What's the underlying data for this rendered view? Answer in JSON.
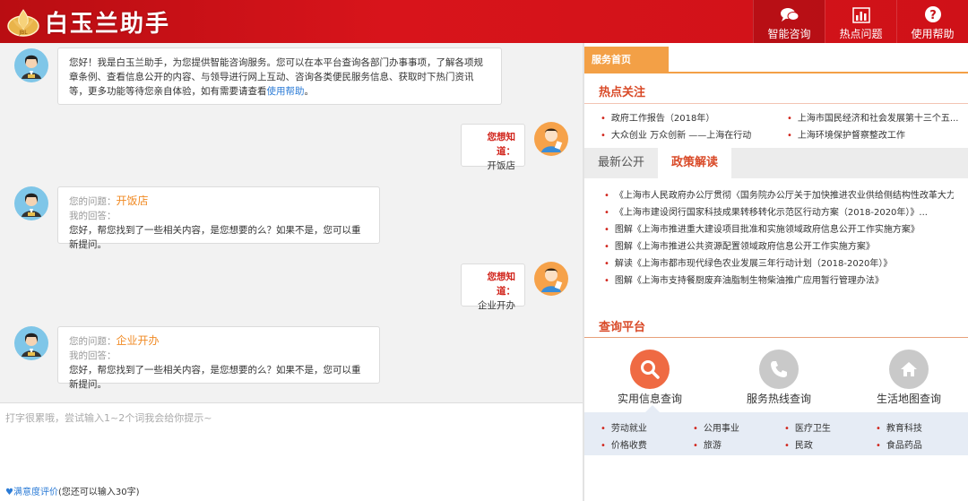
{
  "header": {
    "title": "白玉兰助手",
    "logo_icon": "magnolia-emblem-icon",
    "nav": [
      {
        "label": "智能咨询",
        "icon": "chat-bubbles-icon"
      },
      {
        "label": "热点问题",
        "icon": "bar-chart-icon"
      },
      {
        "label": "使用帮助",
        "icon": "question-circle-icon"
      }
    ],
    "brand_color": "#d8141b"
  },
  "chat": {
    "welcome": {
      "text": "您好！我是白玉兰助手，为您提供智能咨询服务。您可以在本平台查询各部门办事事项，了解各项规章条例、查看信息公开的内容、与领导进行网上互动、咨询各类便民服务信息、获取时下热门资讯等，更多功能等待您亲自体验，如有需要请查看",
      "link": "使用帮助",
      "end": "。"
    },
    "messages": [
      {
        "user_title": "您想知道：",
        "user_text": "开饭店",
        "q_label": "您的问题：",
        "q_value": "开饭店",
        "a_label": "我的回答：",
        "a_text": "您好，帮您找到了一些相关内容，是您想要的么？如果不是，您可以重新提问。"
      },
      {
        "user_title": "您想知道：",
        "user_text": "企业开办",
        "q_label": "您的问题：",
        "q_value": "企业开办",
        "a_label": "我的回答：",
        "a_text": "您好，帮您找到了一些相关内容，是您想要的么？如果不是，您可以重新提问。"
      }
    ]
  },
  "input": {
    "placeholder": "打字很累哦，尝试输入1~2个词我会给你提示~",
    "rating_link": "满意度评价",
    "rating_hint": "(您还可以输入30字)"
  },
  "right": {
    "service_tab": "服务首页",
    "hot_title": "热点关注",
    "hot_items": [
      "政府工作报告（2018年）",
      "上海市国民经济和社会发展第十三个五...",
      "大众创业 万众创新 ——上海在行动",
      "上海环境保护督察整改工作"
    ],
    "tabs": {
      "latest": "最新公开",
      "policy": "政策解读"
    },
    "policy_items": [
      "《上海市人民政府办公厅贯彻〈国务院办公厅关于加快推进农业供给侧结构性改革大力...",
      "《上海市建设闵行国家科技成果转移转化示范区行动方案（2018-2020年）》...",
      "图解《上海市推进重大建设项目批准和实施领域政府信息公开工作实施方案》",
      "图解《上海市推进公共资源配置领域政府信息公开工作实施方案》",
      "解读《上海市都市现代绿色农业发展三年行动计划（2018-2020年）》",
      "图解《上海市支持餐厨废弃油脂制生物柴油推广应用暂行管理办法》"
    ],
    "query_title": "查询平台",
    "query_items": [
      {
        "label": "实用信息查询",
        "icon": "search-icon",
        "color": "#ef6a43"
      },
      {
        "label": "服务热线查询",
        "icon": "phone-icon",
        "color": "#c9c9c9"
      },
      {
        "label": "生活地图查询",
        "icon": "home-icon",
        "color": "#c9c9c9"
      }
    ],
    "categories": [
      "劳动就业",
      "公用事业",
      "医疗卫生",
      "教育科技",
      "价格收费",
      "旅游",
      "民政",
      "食品药品"
    ]
  }
}
